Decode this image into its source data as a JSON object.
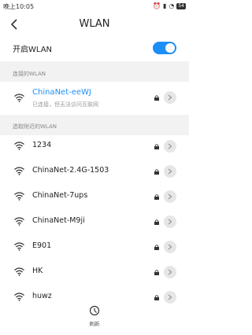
{
  "status_bar": {
    "time": "晚上10:05",
    "battery": "54"
  },
  "header": {
    "title": "WLAN"
  },
  "wlan_toggle": {
    "label": "开启WLAN",
    "state": "on"
  },
  "connected_section": {
    "title": "连接的WLAN",
    "network": {
      "ssid": "ChinaNet-eeWJ",
      "status": "已连接，但无法访问互联网"
    }
  },
  "nearby_section": {
    "title": "选取附近的WLAN",
    "networks": [
      {
        "ssid": "1234"
      },
      {
        "ssid": "ChinaNet-2.4G-1503"
      },
      {
        "ssid": "ChinaNet-7ups"
      },
      {
        "ssid": "ChinaNet-M9ji"
      },
      {
        "ssid": "E901"
      },
      {
        "ssid": "HK"
      },
      {
        "ssid": "huwz"
      }
    ]
  },
  "refresh": {
    "label": "刷新"
  },
  "colors": {
    "accent": "#1e8ef7",
    "separator": "#f2f2f2"
  }
}
